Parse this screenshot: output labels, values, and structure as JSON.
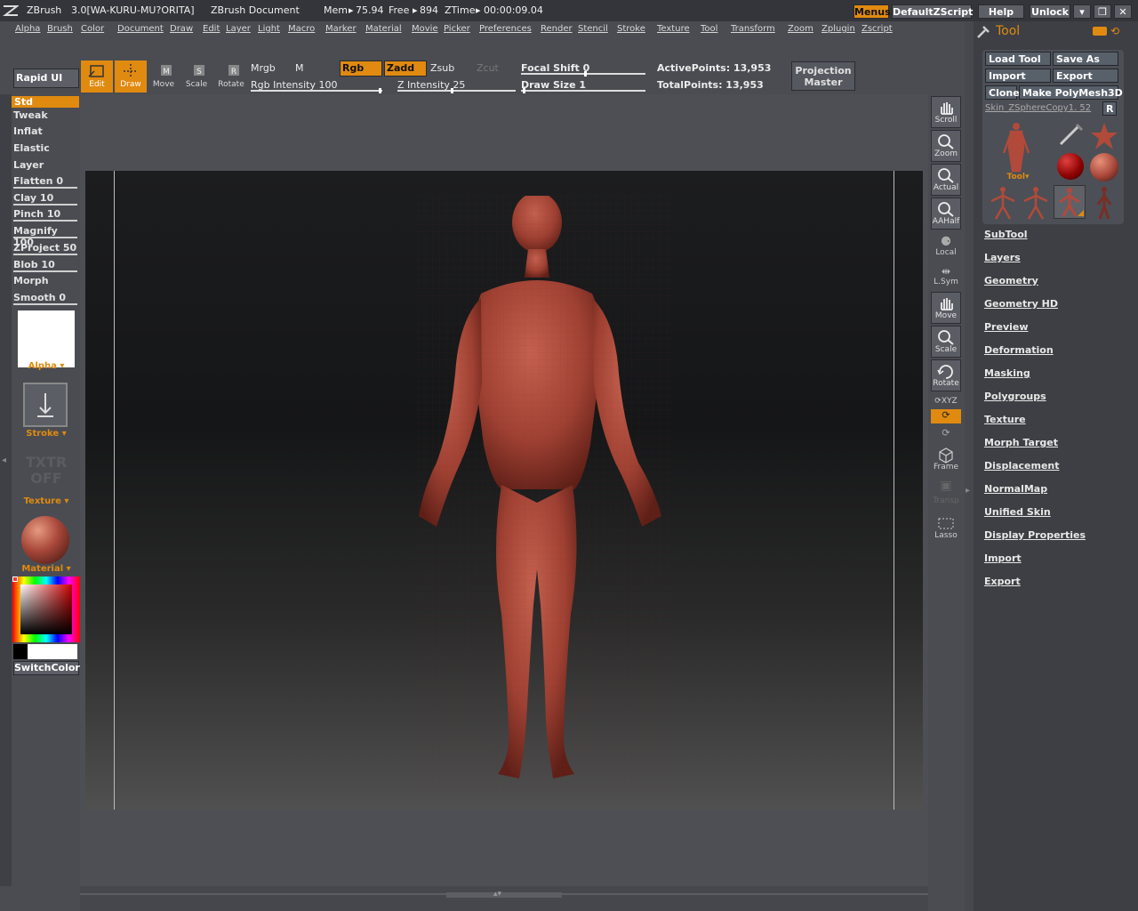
{
  "titlebar": {
    "app": "ZBrush",
    "version": "3.0[WA-KURU-MU?ORITA]",
    "document": "ZBrush Document",
    "mem_label": "Mem",
    "mem_value": "75.94",
    "free_label": "Free",
    "free_value": "894",
    "ztime_label": "ZTime",
    "ztime_value": "00:00:09.04",
    "buttons": [
      "Menus",
      "DefaultZScript",
      "Help",
      "Unlock"
    ]
  },
  "menubar": [
    "Alpha",
    "Brush",
    "Color",
    "Document",
    "Draw",
    "Edit",
    "Layer",
    "Light",
    "Macro",
    "Marker",
    "Material",
    "Movie",
    "Picker",
    "Preferences",
    "Render",
    "Stencil",
    "Stroke",
    "Texture",
    "Tool",
    "Transform",
    "Zoom",
    "Zplugin",
    "Zscript"
  ],
  "topbar": {
    "rapid_ui": "Rapid UI",
    "edit": "Edit",
    "draw": "Draw",
    "move": "Move",
    "scale": "Scale",
    "rotate": "Rotate",
    "mrgb": "Mrgb",
    "m": "M",
    "rgb": "Rgb",
    "zadd": "Zadd",
    "zsub": "Zsub",
    "zcut": "Zcut",
    "rgb_intensity": "Rgb Intensity 100",
    "z_intensity": "Z Intensity 25",
    "focal_shift": "Focal Shift 0",
    "draw_size": "Draw Size 1",
    "active_points": "ActivePoints: 13,953",
    "total_points": "TotalPoints: 13,953",
    "projection_master_1": "Projection",
    "projection_master_2": "Master"
  },
  "brushes": [
    {
      "label": "Std",
      "selected": true
    },
    {
      "label": "Tweak"
    },
    {
      "label": "Inflat"
    },
    {
      "label": "Elastic"
    },
    {
      "label": "Layer"
    },
    {
      "label": "Flatten 0",
      "slider": true
    },
    {
      "label": "Clay 10",
      "slider": true
    },
    {
      "label": "Pinch 10",
      "slider": true
    },
    {
      "label": "Magnify 100",
      "slider": true
    },
    {
      "label": "ZProject 50",
      "slider": true
    },
    {
      "label": "Blob 10",
      "slider": true
    },
    {
      "label": "Morph"
    },
    {
      "label": "Smooth 0",
      "slider": true
    }
  ],
  "leftshelf": {
    "alpha": "Alpha",
    "stroke": "Stroke",
    "texture_off_1": "TXTR",
    "texture_off_2": "OFF",
    "texture": "Texture",
    "material": "Material",
    "switch_color": "SwitchColor"
  },
  "rightshelf": {
    "scroll": "Scroll",
    "zoom": "Zoom",
    "actual": "Actual",
    "aahalf": "AAHalf",
    "local": "Local",
    "lsym": "L.Sym",
    "move": "Move",
    "scale": "Scale",
    "rotate": "Rotate",
    "xyz": "XYZ",
    "frame": "Frame",
    "transp": "Transp",
    "lasso": "Lasso"
  },
  "toolpanel": {
    "title": "Tool",
    "load_tool": "Load Tool",
    "save_as": "Save As",
    "import": "Import",
    "export": "Export",
    "clone": "Clone",
    "make_polymesh": "Make PolyMesh3D",
    "current_tool": "Skin_ZSphereCopy1. 52",
    "r": "R",
    "tool_label": "Tool",
    "menu_items": [
      "SubTool",
      "Layers",
      "Geometry",
      "Geometry HD",
      "Preview",
      "Deformation",
      "Masking",
      "Polygroups",
      "Texture",
      "Morph Target",
      "Displacement",
      "NormalMap",
      "Unified Skin",
      "Display Properties",
      "Import",
      "Export"
    ]
  },
  "colors": {
    "accent": "#e08a10",
    "background": "#4a4c52",
    "model": "#a8473a"
  }
}
